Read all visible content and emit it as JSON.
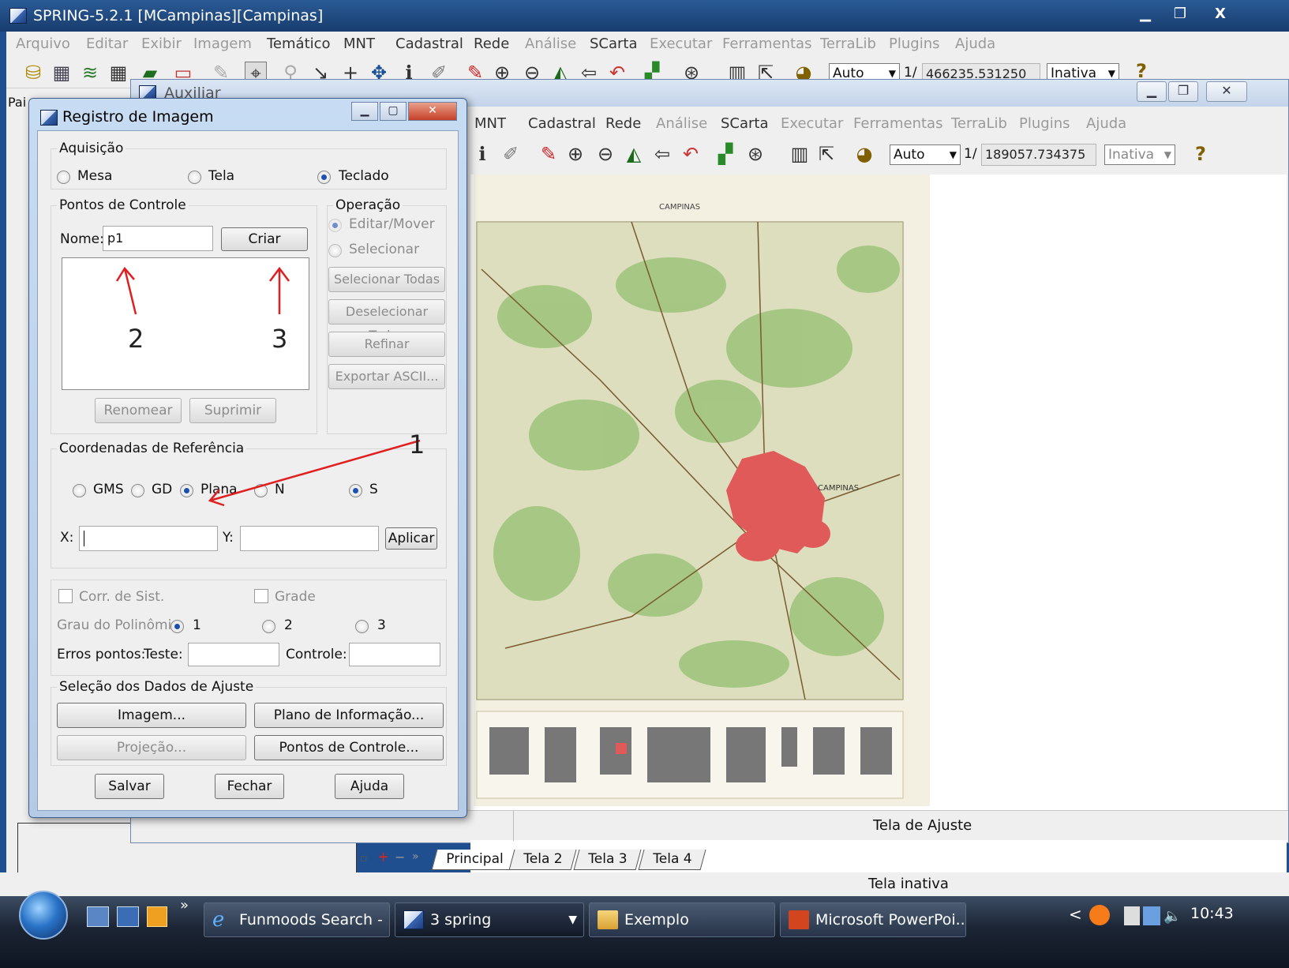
{
  "main_window": {
    "title": "SPRING-5.2.1 [MCampinas][Campinas]",
    "controls": [
      "▁",
      "❐",
      "X"
    ],
    "menu": [
      {
        "label": "Arquivo",
        "enabled": false
      },
      {
        "label": "Editar",
        "enabled": false
      },
      {
        "label": "Exibir",
        "enabled": false
      },
      {
        "label": "Imagem",
        "enabled": false
      },
      {
        "label": "Temático",
        "enabled": true
      },
      {
        "label": "MNT",
        "enabled": true
      },
      {
        "label": "Cadastral",
        "enabled": true
      },
      {
        "label": "Rede",
        "enabled": true
      },
      {
        "label": "Análise",
        "enabled": false
      },
      {
        "label": "SCarta",
        "enabled": true
      },
      {
        "label": "Executar",
        "enabled": false
      },
      {
        "label": "Ferramentas",
        "enabled": false
      },
      {
        "label": "TerraLib",
        "enabled": false
      },
      {
        "label": "Plugins",
        "enabled": false
      },
      {
        "label": "Ajuda",
        "enabled": false
      }
    ],
    "toolbar": {
      "zoom_mode": "Auto",
      "scale_prefix": "1/",
      "scale_value": "466235.531250",
      "state": "Inativa",
      "help_glyph": "?"
    },
    "left_panel_label": "Pai"
  },
  "aux_window": {
    "title": "Auxiliar",
    "menu": [
      {
        "label": "MNT",
        "enabled": true
      },
      {
        "label": "Cadastral",
        "enabled": true
      },
      {
        "label": "Rede",
        "enabled": true
      },
      {
        "label": "Análise",
        "enabled": false
      },
      {
        "label": "SCarta",
        "enabled": true
      },
      {
        "label": "Executar",
        "enabled": false
      },
      {
        "label": "Ferramentas",
        "enabled": false
      },
      {
        "label": "TerraLib",
        "enabled": false
      },
      {
        "label": "Plugins",
        "enabled": false
      },
      {
        "label": "Ajuda",
        "enabled": false
      }
    ],
    "toolbar": {
      "zoom_mode": "Auto",
      "scale_prefix": "1/",
      "scale_value": "189057.734375",
      "state": "Inativa",
      "help_glyph": "?"
    },
    "map_header_title": "CAMPINAS",
    "map_city_label": "CAMPINAS",
    "status_text": "Tela de Ajuste"
  },
  "screen_tabs": [
    "Principal",
    "Tela 2",
    "Tela 3",
    "Tela 4"
  ],
  "tab_controls": [
    "▫",
    "+",
    "−",
    "»"
  ],
  "bottom_status": "Tela inativa",
  "registro_dialog": {
    "title": "Registro de Imagem",
    "aquisicao": {
      "label": "Aquisição",
      "options": [
        "Mesa",
        "Tela",
        "Teclado"
      ],
      "selected": "Teclado"
    },
    "pontos_controle": {
      "label": "Pontos de Controle",
      "nome_label": "Nome:",
      "nome_value": "p1",
      "criar_button": "Criar",
      "renomear_button": "Renomear",
      "suprimir_button": "Suprimir"
    },
    "operacao": {
      "label": "Operação",
      "options": [
        "Editar/Mover",
        "Selecionar"
      ],
      "selecionar_todas": "Selecionar Todas",
      "deselecionar_todas": "Deselecionar Todas",
      "refinar": "Refinar",
      "exportar": "Exportar ASCII..."
    },
    "coordenadas": {
      "label": "Coordenadas de Referência",
      "options": [
        "GMS",
        "GD",
        "Plana",
        "N",
        "S"
      ],
      "selected": [
        "Plana",
        "S"
      ],
      "x_label": "X:",
      "y_label": "Y:",
      "x_value": "",
      "y_value": "",
      "aplicar_button": "Aplicar"
    },
    "ajuste": {
      "corr_sist": "Corr. de Sist.",
      "grade": "Grade",
      "grau_label": "Grau do Polinômio:",
      "grau_options": [
        "1",
        "2",
        "3"
      ],
      "grau_selected": "1",
      "erros_label": "Erros pontos:",
      "teste_label": "Teste:",
      "controle_label": "Controle:"
    },
    "selecao": {
      "label": "Seleção dos Dados de Ajuste",
      "imagem_button": "Imagem...",
      "plano_button": "Plano de Informação...",
      "projecao_button": "Projeção...",
      "pontos_button": "Pontos de Controle..."
    },
    "footer": {
      "salvar": "Salvar",
      "fechar": "Fechar",
      "ajuda": "Ajuda"
    }
  },
  "annotations": {
    "arrow_color": "#e02020",
    "labels": [
      "1",
      "2",
      "3"
    ]
  },
  "taskbar": {
    "quick_launch_chevron": "»",
    "items": [
      {
        "label": "Funmoods Search - ...",
        "icon": "ie-icon",
        "active": false
      },
      {
        "label": "3 spring",
        "icon": "spring-app-icon",
        "active": true
      },
      {
        "label": "Exemplo",
        "icon": "folder-icon",
        "active": false
      },
      {
        "label": "Microsoft PowerPoi...",
        "icon": "powerpoint-icon",
        "active": false
      }
    ],
    "tray_chevron": "<",
    "clock": "10:43"
  },
  "colors": {
    "urban_area": "#e05a5a",
    "vegetation": "#9cc47a",
    "map_paper": "#f3f0e2",
    "window_frame": "#b5cbe5"
  }
}
